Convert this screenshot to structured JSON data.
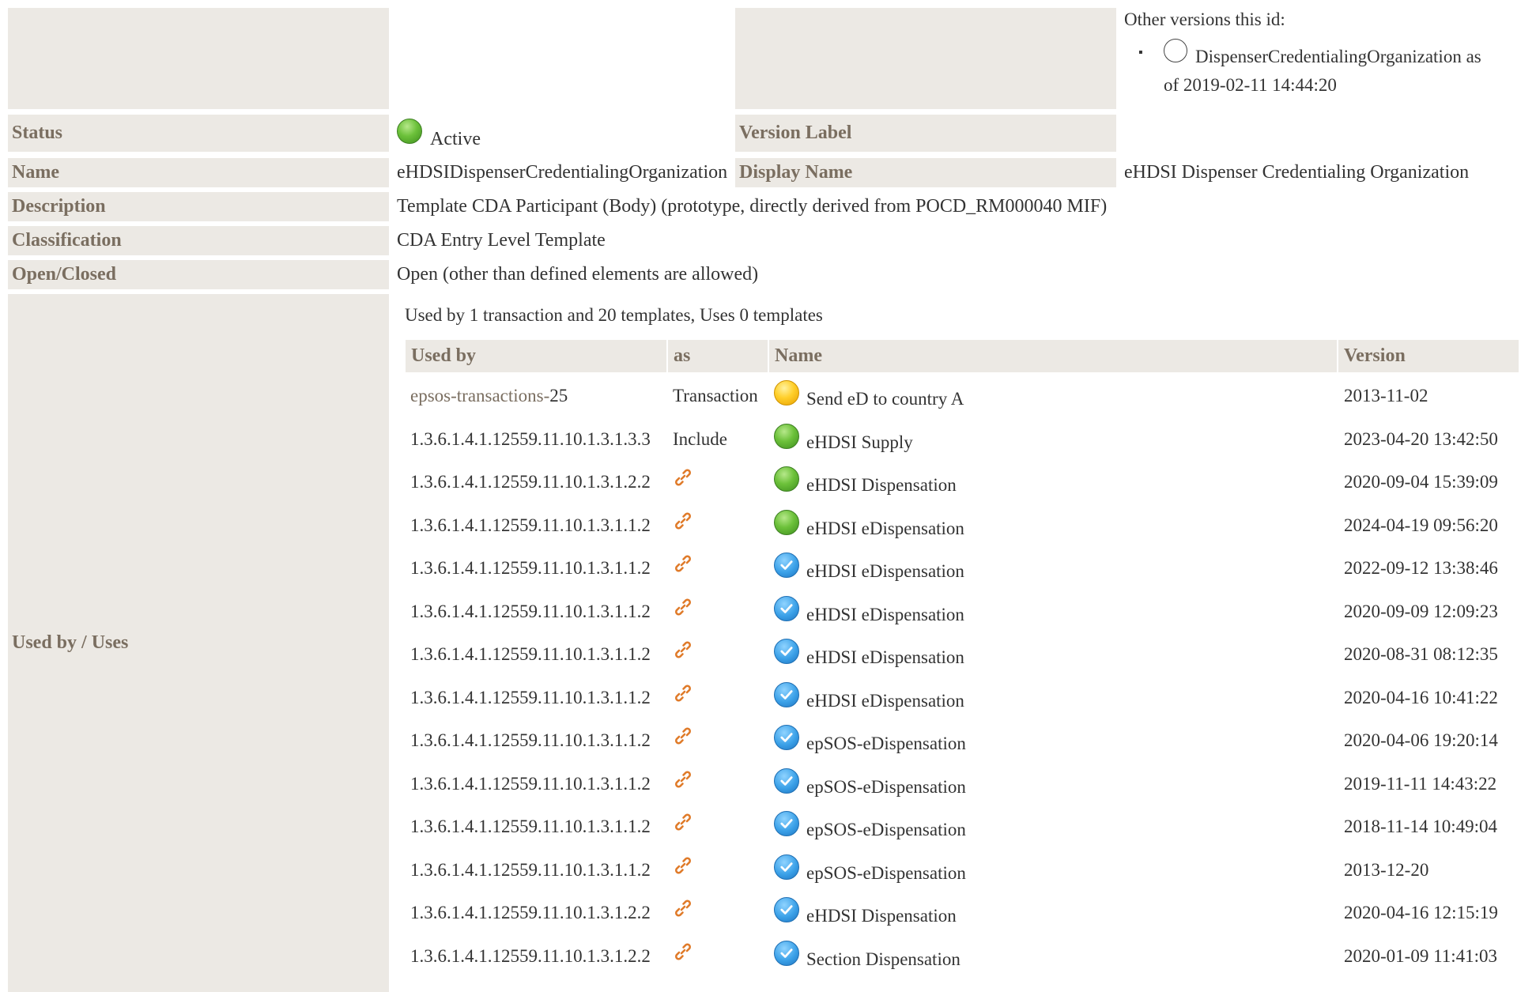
{
  "other_versions": {
    "title": "Other versions this id:",
    "item_bullet": "▪",
    "item_line1": "DispenserCredentialingOrganization as",
    "item_line2": "of 2019-02-11 14:44:20"
  },
  "fields": {
    "status_label": "Status",
    "status_value": "Active",
    "version_label_label": "Version Label",
    "name_label": "Name",
    "name_value": "eHDSIDispenserCredentialingOrganization",
    "display_name_label": "Display Name",
    "display_name_value": "eHDSI Dispenser Credentialing Organization",
    "description_label": "Description",
    "description_value": "Template CDA Participant (Body) (prototype, directly derived from POCD_RM000040 MIF)",
    "classification_label": "Classification",
    "classification_value": "CDA Entry Level Template",
    "open_closed_label": "Open/Closed",
    "open_closed_value": "Open (other than defined elements are allowed)",
    "used_by_label": "Used by / Uses"
  },
  "usage": {
    "summary": "Used by 1 transaction and 20 templates, Uses 0 templates",
    "headers": {
      "used_by": "Used by",
      "as": "as",
      "name": "Name",
      "version": "Version"
    },
    "rows": [
      {
        "used_by_prefix": "epsos-transactions-",
        "used_by_suffix": "25",
        "as": "Transaction",
        "status": "yellow",
        "name": "Send eD to country A",
        "version": "2013-11-02"
      },
      {
        "used_by": "1.3.6.1.4.1.12559.11.10.1.3.1.3.3",
        "as": "Include",
        "status": "green",
        "name": "eHDSI Supply",
        "version": "2023-04-20 13:42:50"
      },
      {
        "used_by": "1.3.6.1.4.1.12559.11.10.1.3.1.2.2",
        "as": "link-icon",
        "status": "green",
        "name": "eHDSI Dispensation",
        "version": "2020-09-04 15:39:09"
      },
      {
        "used_by": "1.3.6.1.4.1.12559.11.10.1.3.1.1.2",
        "as": "link-icon",
        "status": "green",
        "name": "eHDSI eDispensation",
        "version": "2024-04-19 09:56:20"
      },
      {
        "used_by": "1.3.6.1.4.1.12559.11.10.1.3.1.1.2",
        "as": "link-icon",
        "status": "blue",
        "name": "eHDSI eDispensation",
        "version": "2022-09-12 13:38:46"
      },
      {
        "used_by": "1.3.6.1.4.1.12559.11.10.1.3.1.1.2",
        "as": "link-icon",
        "status": "blue",
        "name": "eHDSI eDispensation",
        "version": "2020-09-09 12:09:23"
      },
      {
        "used_by": "1.3.6.1.4.1.12559.11.10.1.3.1.1.2",
        "as": "link-icon",
        "status": "blue",
        "name": "eHDSI eDispensation",
        "version": "2020-08-31 08:12:35"
      },
      {
        "used_by": "1.3.6.1.4.1.12559.11.10.1.3.1.1.2",
        "as": "link-icon",
        "status": "blue",
        "name": "eHDSI eDispensation",
        "version": "2020-04-16 10:41:22"
      },
      {
        "used_by": "1.3.6.1.4.1.12559.11.10.1.3.1.1.2",
        "as": "link-icon",
        "status": "blue",
        "name": "epSOS-eDispensation",
        "version": "2020-04-06 19:20:14"
      },
      {
        "used_by": "1.3.6.1.4.1.12559.11.10.1.3.1.1.2",
        "as": "link-icon",
        "status": "blue",
        "name": "epSOS-eDispensation",
        "version": "2019-11-11 14:43:22"
      },
      {
        "used_by": "1.3.6.1.4.1.12559.11.10.1.3.1.1.2",
        "as": "link-icon",
        "status": "blue",
        "name": "epSOS-eDispensation",
        "version": "2018-11-14 10:49:04"
      },
      {
        "used_by": "1.3.6.1.4.1.12559.11.10.1.3.1.1.2",
        "as": "link-icon",
        "status": "blue",
        "name": "epSOS-eDispensation",
        "version": "2013-12-20"
      },
      {
        "used_by": "1.3.6.1.4.1.12559.11.10.1.3.1.2.2",
        "as": "link-icon",
        "status": "blue",
        "name": "eHDSI Dispensation",
        "version": "2020-04-16 12:15:19"
      },
      {
        "used_by": "1.3.6.1.4.1.12559.11.10.1.3.1.2.2",
        "as": "link-icon",
        "status": "blue",
        "name": "Section Dispensation",
        "version": "2020-01-09 11:41:03"
      }
    ]
  },
  "colors": {
    "label_bg": "#ece9e4",
    "label_text": "#7a6e60",
    "link_icon": "#e07b2a"
  }
}
